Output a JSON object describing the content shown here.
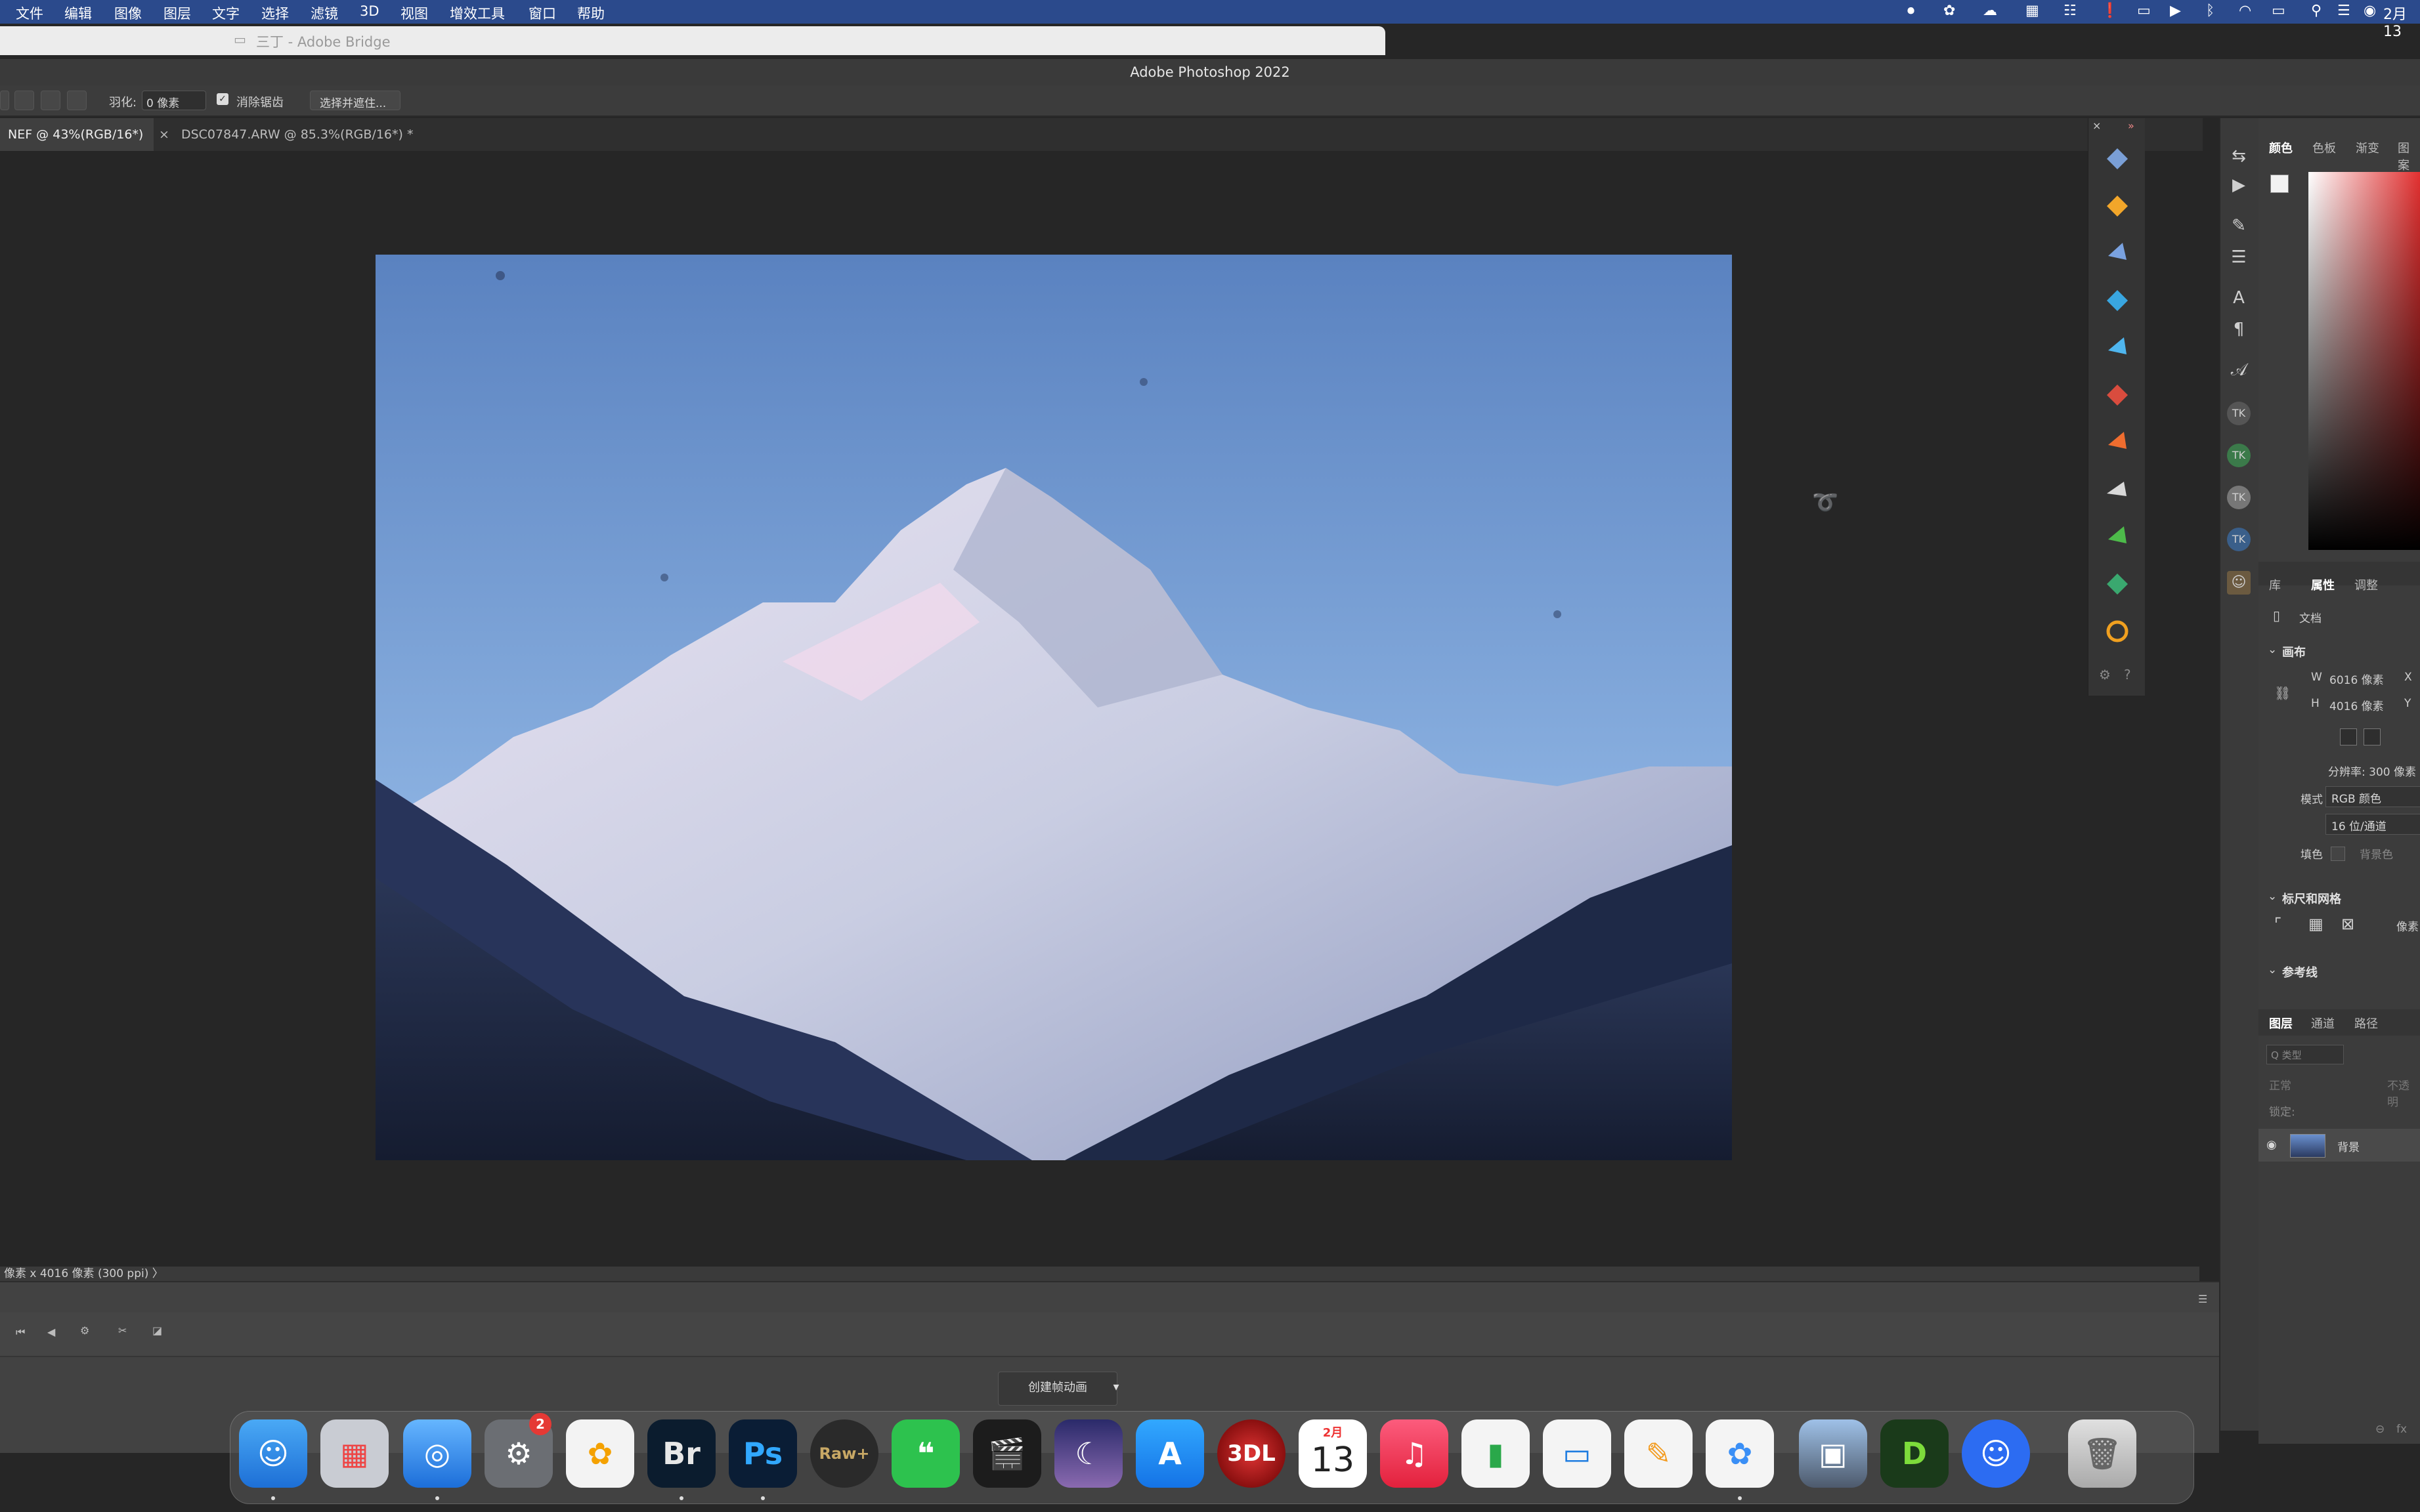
{
  "menubar": {
    "items": [
      "文件",
      "编辑",
      "图像",
      "图层",
      "文字",
      "选择",
      "滤镜",
      "3D",
      "视图",
      "增效工具",
      "窗口",
      "帮助"
    ],
    "clock": "2月13"
  },
  "bridge": {
    "title": "三丁 - Adobe Bridge"
  },
  "photoshop": {
    "title": "Adobe Photoshop 2022"
  },
  "options": {
    "feather_label": "羽化:",
    "feather_value": "0 像素",
    "antialias_label": "消除锯齿",
    "select_mask_button": "选择并遮住..."
  },
  "tabs": [
    {
      "label": "NEF @ 43%(RGB/16*) *"
    },
    {
      "close": "×",
      "label": "DSC07847.ARW @ 85.3%(RGB/16*) *"
    }
  ],
  "status": {
    "text": "像素 x 4016 像素 (300 ppi) 〉"
  },
  "timeline": {
    "create_animation": "创建帧动画",
    "dropdown": "▾"
  },
  "panel_color": {
    "tabs": [
      "颜色",
      "色板",
      "渐变",
      "图案"
    ]
  },
  "panel_props": {
    "tabs": [
      "库",
      "属性",
      "调整"
    ],
    "doc_label": "文档",
    "canvas_section": "画布",
    "w_label": "W",
    "w_value": "6016 像素",
    "w_axis": "X",
    "h_label": "H",
    "h_value": "4016 像素",
    "h_axis": "Y",
    "resolution": "分辨率: 300 像素",
    "mode_label": "模式",
    "mode_value": "RGB 颜色",
    "depth_value": "16 位/通道",
    "fill_label": "填色",
    "fill_value": "背景色",
    "rulers_section": "标尺和网格",
    "rulers_unit": "像素",
    "guides_section": "参考线"
  },
  "panel_layers": {
    "tabs": [
      "图层",
      "通道",
      "路径"
    ],
    "search_placeholder": "Q 类型",
    "blend_mode": "正常",
    "opacity": "不透明",
    "lock_label": "锁定:",
    "layer_name": "背景",
    "footer_fx": "fx"
  },
  "dock": {
    "apps": [
      {
        "name": "Finder",
        "glyph": ""
      },
      {
        "name": "Launchpad",
        "glyph": ""
      },
      {
        "name": "Safari",
        "glyph": ""
      },
      {
        "name": "System Preferences",
        "glyph": "",
        "badge": "2"
      },
      {
        "name": "Photos",
        "glyph": ""
      },
      {
        "name": "Bridge",
        "glyph": "Br"
      },
      {
        "name": "Photoshop",
        "glyph": "Ps"
      },
      {
        "name": "Raw+",
        "glyph": "Raw+"
      },
      {
        "name": "WeChat",
        "glyph": ""
      },
      {
        "name": "Final Cut Pro",
        "glyph": ""
      },
      {
        "name": "Night",
        "glyph": ""
      },
      {
        "name": "App Store",
        "glyph": "A"
      },
      {
        "name": "3DLUT",
        "glyph": "3DL"
      },
      {
        "name": "Calendar",
        "month": "2月",
        "day": "13"
      },
      {
        "name": "Music",
        "glyph": "♫"
      },
      {
        "name": "Numbers",
        "glyph": ""
      },
      {
        "name": "Keynote",
        "glyph": ""
      },
      {
        "name": "Pages",
        "glyph": ""
      },
      {
        "name": "Baidu Netdisk",
        "glyph": ""
      },
      {
        "name": "Preview",
        "glyph": ""
      },
      {
        "name": "DxO",
        "glyph": "D"
      },
      {
        "name": "Smiley",
        "glyph": ""
      },
      {
        "name": "Trash",
        "glyph": ""
      }
    ]
  },
  "colors": {
    "menubar": "#2b4a8c",
    "ps_bg": "#262626",
    "sky_top": "#5f87c4",
    "sky_bottom": "#8fb4e3",
    "snow": "#dcdcec"
  }
}
